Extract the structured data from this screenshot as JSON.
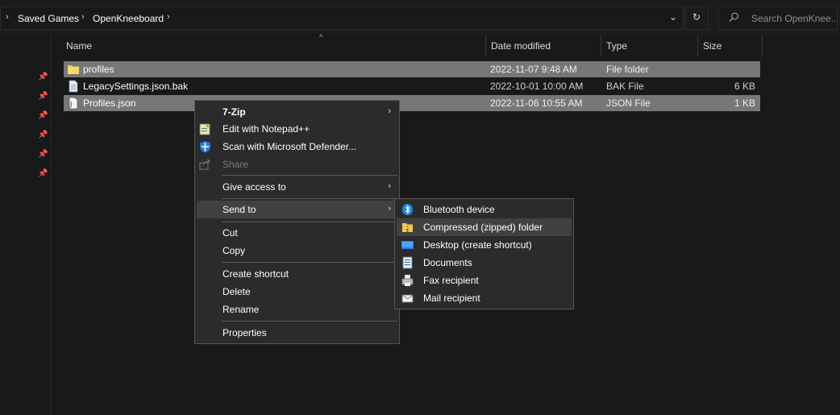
{
  "breadcrumb": {
    "root_arrow": "›",
    "items": [
      "Saved Games",
      "OpenKneeboard"
    ],
    "trailing_arrow": "›"
  },
  "address_controls": {
    "dropdown": "⌄",
    "refresh": "↻"
  },
  "search": {
    "placeholder": "Search OpenKnee...",
    "icon": "search-icon"
  },
  "columns": {
    "name": "Name",
    "date": "Date modified",
    "type": "Type",
    "size": "Size",
    "sort_indicator": "^"
  },
  "files": [
    {
      "name": "profiles",
      "date": "2022-11-07 9:48 AM",
      "type": "File folder",
      "size": "",
      "icon": "folder-icon"
    },
    {
      "name": "LegacySettings.json.bak",
      "date": "2022-10-01 10:00 AM",
      "type": "BAK File",
      "size": "6 KB",
      "icon": "file-icon"
    },
    {
      "name": "Profiles.json",
      "date": "2022-11-06 10:55 AM",
      "type": "JSON File",
      "size": "1 KB",
      "icon": "json-file-icon"
    }
  ],
  "context_menu": {
    "items": {
      "zip": "7-Zip",
      "notepad": "Edit with Notepad++",
      "defender": "Scan with Microsoft Defender...",
      "share": "Share",
      "give_access": "Give access to",
      "send_to": "Send to",
      "cut": "Cut",
      "copy": "Copy",
      "create_shortcut": "Create shortcut",
      "delete": "Delete",
      "rename": "Rename",
      "properties": "Properties"
    },
    "arrow": "›"
  },
  "send_to_menu": {
    "items": [
      {
        "label": "Bluetooth device",
        "icon": "bluetooth-icon"
      },
      {
        "label": "Compressed (zipped) folder",
        "icon": "zip-folder-icon"
      },
      {
        "label": "Desktop (create shortcut)",
        "icon": "desktop-icon"
      },
      {
        "label": "Documents",
        "icon": "documents-icon"
      },
      {
        "label": "Fax recipient",
        "icon": "fax-icon"
      },
      {
        "label": "Mail recipient",
        "icon": "mail-icon"
      }
    ]
  },
  "colors": {
    "selection": "#777777",
    "menu_bg": "#2b2b2b",
    "menu_hover": "#414141",
    "folder": "#f2c94c",
    "accent": "#1e7fd8"
  }
}
